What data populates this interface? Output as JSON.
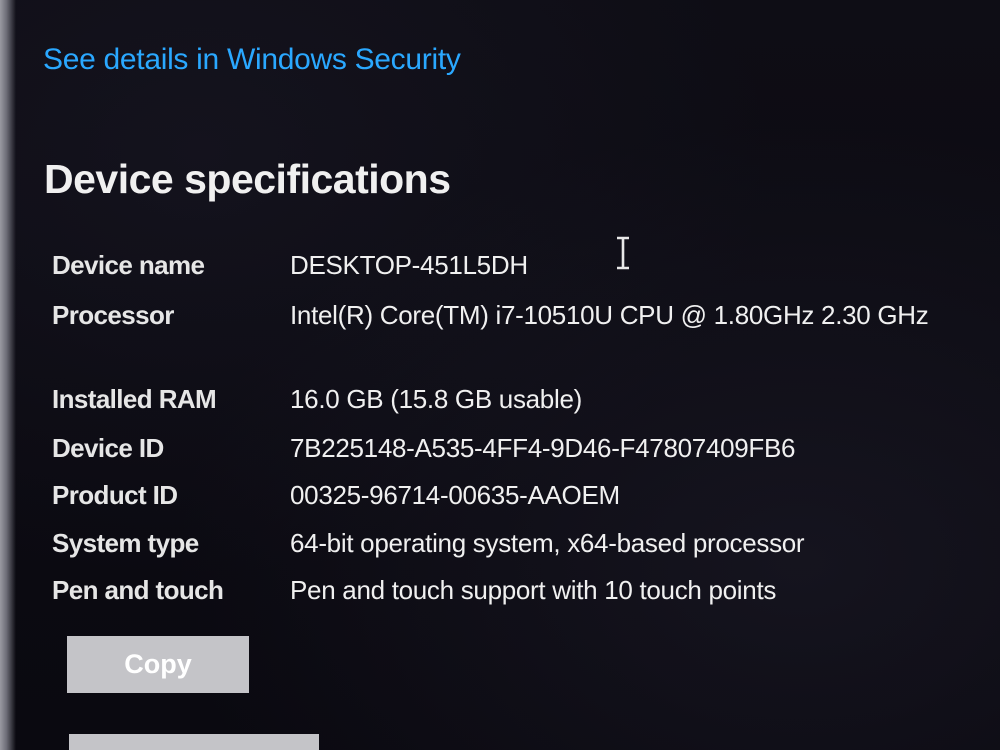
{
  "link": {
    "security": "See details in Windows Security"
  },
  "section": {
    "title": "Device specifications"
  },
  "specs": [
    {
      "label": "Device name",
      "value": "DESKTOP-451L5DH"
    },
    {
      "label": "Processor",
      "value": "Intel(R) Core(TM) i7-10510U CPU @ 1.80GHz   2.30 GHz"
    },
    {
      "label": "Installed RAM",
      "value": "16.0 GB (15.8 GB usable)"
    },
    {
      "label": "Device ID",
      "value": "7B225148-A535-4FF4-9D46-F47807409FB6"
    },
    {
      "label": "Product ID",
      "value": "00325-96714-00635-AAOEM"
    },
    {
      "label": "System type",
      "value": "64-bit operating system, x64-based processor"
    },
    {
      "label": "Pen and touch",
      "value": "Pen and touch support with 10 touch points"
    }
  ],
  "buttons": {
    "copy_label": "Copy"
  },
  "icons": {
    "cursor": "text-cursor-icon"
  },
  "colors": {
    "background": "#0b0a12",
    "link": "#2aa8ff",
    "button": "#c4c4c8"
  }
}
